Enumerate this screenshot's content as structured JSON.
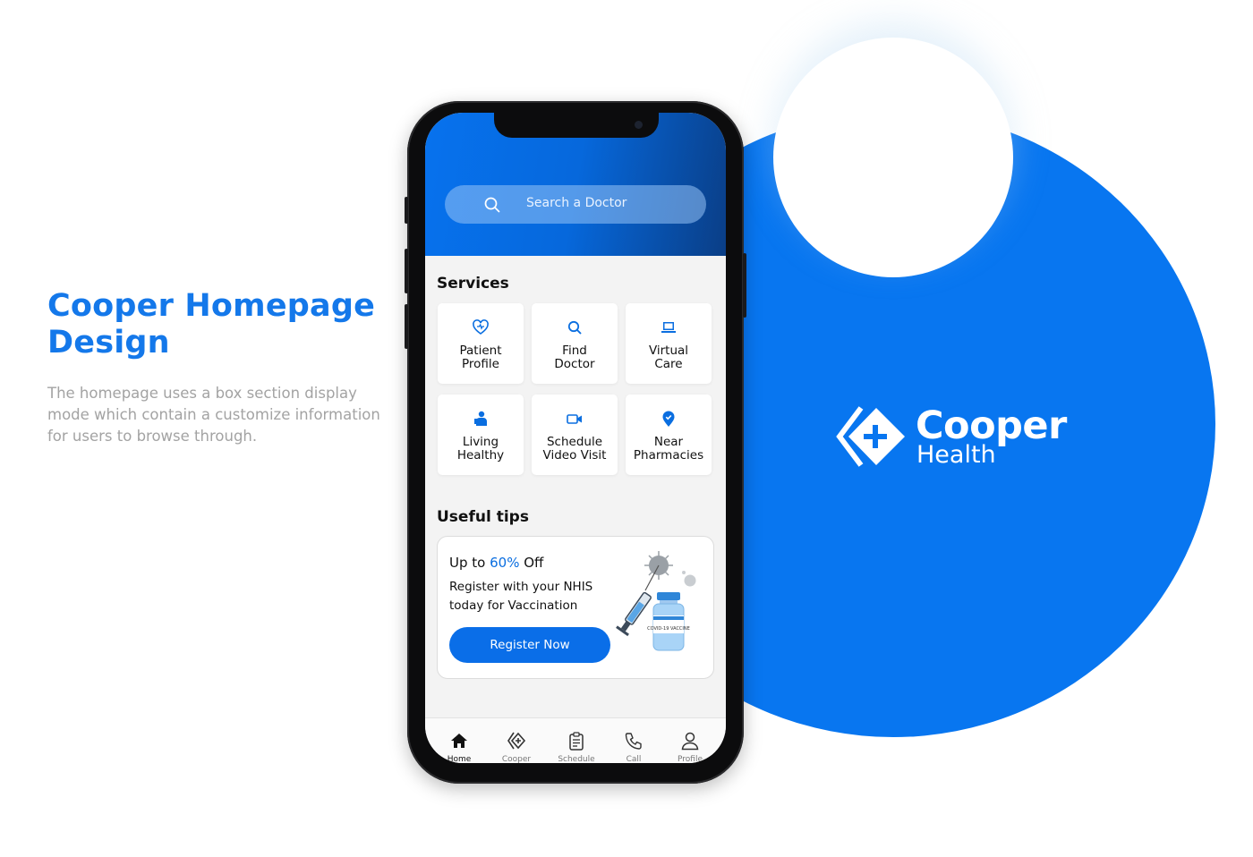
{
  "intro": {
    "title_line1": "Cooper Homepage",
    "title_line2": "Design",
    "description": "The homepage uses a box section display mode which contain a customize information for users to browse through."
  },
  "brand": {
    "name": "Cooper",
    "sub": "Health"
  },
  "app": {
    "search": {
      "placeholder": "Search a Doctor"
    },
    "services": {
      "title": "Services",
      "items": [
        {
          "line1": "Patient",
          "line2": "Profile",
          "icon": "heart-icon"
        },
        {
          "line1": "Find",
          "line2": "Doctor",
          "icon": "search-icon"
        },
        {
          "line1": "Virtual",
          "line2": "Care",
          "icon": "laptop-icon"
        },
        {
          "line1": "Living",
          "line2": "Healthy",
          "icon": "person-icon"
        },
        {
          "line1": "Schedule",
          "line2": "Video Visit",
          "icon": "video-icon"
        },
        {
          "line1": "Near",
          "line2": "Pharmacies",
          "icon": "location-pin-icon"
        }
      ]
    },
    "tips": {
      "title": "Useful tips",
      "head_pre": "Up to ",
      "head_highlight": "60%",
      "head_post": " Off",
      "body": "Register with your NHIS today for Vaccination",
      "button": "Register Now",
      "vial_label": "COVID-19 VACCINE"
    },
    "tabs": [
      {
        "label": "Home",
        "icon": "home-icon",
        "active": true
      },
      {
        "label": "Cooper",
        "icon": "cooper-icon",
        "active": false
      },
      {
        "label": "Schedule",
        "icon": "clipboard-icon",
        "active": false
      },
      {
        "label": "Call",
        "icon": "phone-icon",
        "active": false
      },
      {
        "label": "Profile",
        "icon": "user-icon",
        "active": false
      }
    ]
  },
  "colors": {
    "primary": "#0876f0",
    "accent": "#0a6ee8",
    "intro_title": "#1478ea",
    "intro_text": "#a3a3a3"
  }
}
